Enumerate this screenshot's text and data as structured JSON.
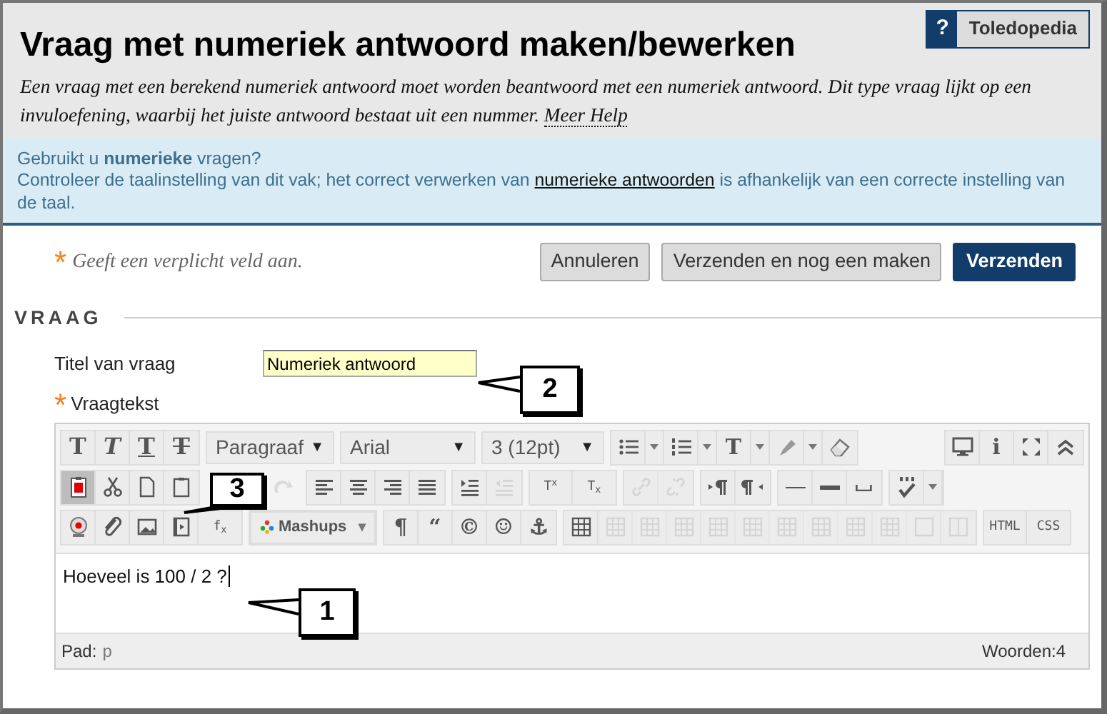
{
  "help_button": {
    "icon_text": "?",
    "label": "Toledopedia"
  },
  "title": "Vraag met numeriek antwoord maken/bewerken",
  "description": {
    "text": "Een vraag met een berekend numeriek antwoord moet worden beantwoord met een numeriek antwoord. Dit type vraag lijkt op een invuloefening, waarbij het juiste antwoord bestaat uit een nummer.",
    "link": "Meer Help"
  },
  "info": {
    "line1": "Gebruikt u **numerieke** vragen?",
    "line2_before": "Controleer de taalinstelling van dit vak; het correct verwerken van",
    "line2_link": "numerieke antwoorden",
    "line2_after": "is afhankelijk van een correcte instelling van de taal."
  },
  "required_note": {
    "mark": "*",
    "text": "Geeft een verplicht veld aan."
  },
  "buttons": [
    {
      "label": "Annuleren",
      "kind": "secondary"
    },
    {
      "label": "Verzenden en nog een maken",
      "kind": "secondary"
    },
    {
      "label": "Verzenden",
      "kind": "primary"
    }
  ],
  "section_heading": "VRAAG",
  "fields": [
    {
      "label": "Titel van vraag",
      "required": false,
      "value": "Numeriek antwoord"
    },
    {
      "label": "Vraagtekst",
      "required": true
    }
  ],
  "editor": {
    "toolbar": [
      [
        [
          {
            "kind": "bold",
            "text": "T"
          },
          {
            "kind": "italic",
            "text": "T"
          },
          {
            "kind": "underline",
            "text": "T"
          },
          {
            "kind": "strike",
            "text": "T"
          }
        ],
        [
          {
            "kind": "select",
            "text": "Paragraaf",
            "caret": "▼"
          },
          {
            "kind": "select",
            "text": "Arial",
            "caret": "▼"
          },
          {
            "kind": "select",
            "text": "3 (12pt)",
            "caret": "▼"
          }
        ],
        [
          {
            "kind": "icon",
            "disabled": false
          },
          {
            "kind": "caret"
          },
          {
            "kind": "icon",
            "disabled": false
          },
          {
            "kind": "caret"
          },
          {
            "kind": "glyph",
            "text": "T",
            "disabled": false
          },
          {
            "kind": "caret"
          },
          {
            "kind": "icon",
            "disabled": false
          },
          {
            "kind": "caret"
          },
          {
            "kind": "icon",
            "disabled": false
          }
        ],
        [
          {
            "kind": "spacer"
          }
        ],
        [
          {
            "kind": "icon",
            "disabled": false
          },
          {
            "kind": "glyph",
            "text": "i",
            "disabled": false
          },
          {
            "kind": "icon",
            "disabled": false
          },
          {
            "kind": "icon",
            "disabled": false
          }
        ]
      ],
      [
        [
          {
            "kind": "icon",
            "pressed": true,
            "disabled": false
          },
          {
            "kind": "icon",
            "pressed": false,
            "disabled": false
          },
          {
            "kind": "icon",
            "pressed": false,
            "disabled": false
          },
          {
            "kind": "icon",
            "pressed": false,
            "disabled": false
          }
        ],
        [
          {
            "kind": "gap"
          },
          {
            "kind": "icon",
            "pressed": false,
            "disabled": true
          }
        ],
        [
          {
            "kind": "icon",
            "pressed": false,
            "disabled": false
          },
          {
            "kind": "icon",
            "pressed": false,
            "disabled": false
          },
          {
            "kind": "icon",
            "pressed": false,
            "disabled": false
          },
          {
            "kind": "icon",
            "pressed": false,
            "disabled": false
          }
        ],
        [
          {
            "kind": "icon",
            "pressed": false,
            "disabled": false
          },
          {
            "kind": "icon",
            "pressed": false,
            "disabled": true
          }
        ],
        [
          {
            "kind": "glyph",
            "text": "T$^{x}$",
            "pressed": false,
            "disabled": false
          },
          {
            "kind": "glyph",
            "text": "T$_{x}$",
            "pressed": false,
            "disabled": false
          }
        ],
        [
          {
            "kind": "icon",
            "pressed": false,
            "disabled": true
          },
          {
            "kind": "icon",
            "pressed": false,
            "disabled": true
          }
        ],
        [
          {
            "kind": "icon",
            "pressed": false,
            "disabled": false
          },
          {
            "kind": "icon",
            "pressed": false,
            "disabled": false
          }
        ],
        [
          {
            "kind": "icon",
            "pressed": false,
            "disabled": false
          },
          {
            "kind": "icon",
            "pressed": false,
            "disabled": false
          },
          {
            "kind": "icon",
            "pressed": false,
            "disabled": false
          }
        ],
        [
          {
            "kind": "icon",
            "disabled": false
          },
          {
            "kind": "caret"
          }
        ]
      ],
      [
        [
          {
            "kind": "icon",
            "disabled": false
          },
          {
            "kind": "icon",
            "disabled": false
          },
          {
            "kind": "icon",
            "disabled": false
          },
          {
            "kind": "icon",
            "disabled": false
          },
          {
            "kind": "glyph",
            "text": "f$_{x}$",
            "disabled": false
          }
        ],
        [
          {
            "kind": "mashups",
            "text": "Mashups",
            "caret": "▾"
          }
        ],
        [
          {
            "kind": "glyph",
            "text": "¶",
            "disabled": false
          },
          {
            "kind": "glyph",
            "text": "“",
            "disabled": false
          },
          {
            "kind": "glyph",
            "text": "©",
            "disabled": false
          },
          {
            "kind": "glyph",
            "text": "☺",
            "disabled": false
          },
          {
            "kind": "glyph",
            "text": "⚓",
            "disabled": false
          }
        ],
        [
          {
            "kind": "icon",
            "disabled": false
          },
          {
            "kind": "icon",
            "disabled": true
          },
          {
            "kind": "icon",
            "disabled": true
          },
          {
            "kind": "icon",
            "disabled": true
          },
          {
            "kind": "icon",
            "disabled": true
          },
          {
            "kind": "icon",
            "disabled": true
          },
          {
            "kind": "icon",
            "disabled": true
          },
          {
            "kind": "icon",
            "disabled": true
          },
          {
            "kind": "icon",
            "disabled": true
          },
          {
            "kind": "icon",
            "disabled": true
          },
          {
            "kind": "icon",
            "disabled": true
          },
          {
            "kind": "icon",
            "disabled": true
          }
        ],
        [
          {
            "kind": "glyph",
            "text": "HTML",
            "disabled": false
          },
          {
            "kind": "glyph",
            "text": "CSS",
            "disabled": false
          }
        ]
      ]
    ],
    "content": "Hoeveel is 100 / 2 ?",
    "path_label": "Pad:",
    "path_value": "p",
    "word_count": "Woorden:4"
  },
  "callouts": [
    {
      "label": "1"
    },
    {
      "label": "2"
    },
    {
      "label": "3"
    }
  ]
}
